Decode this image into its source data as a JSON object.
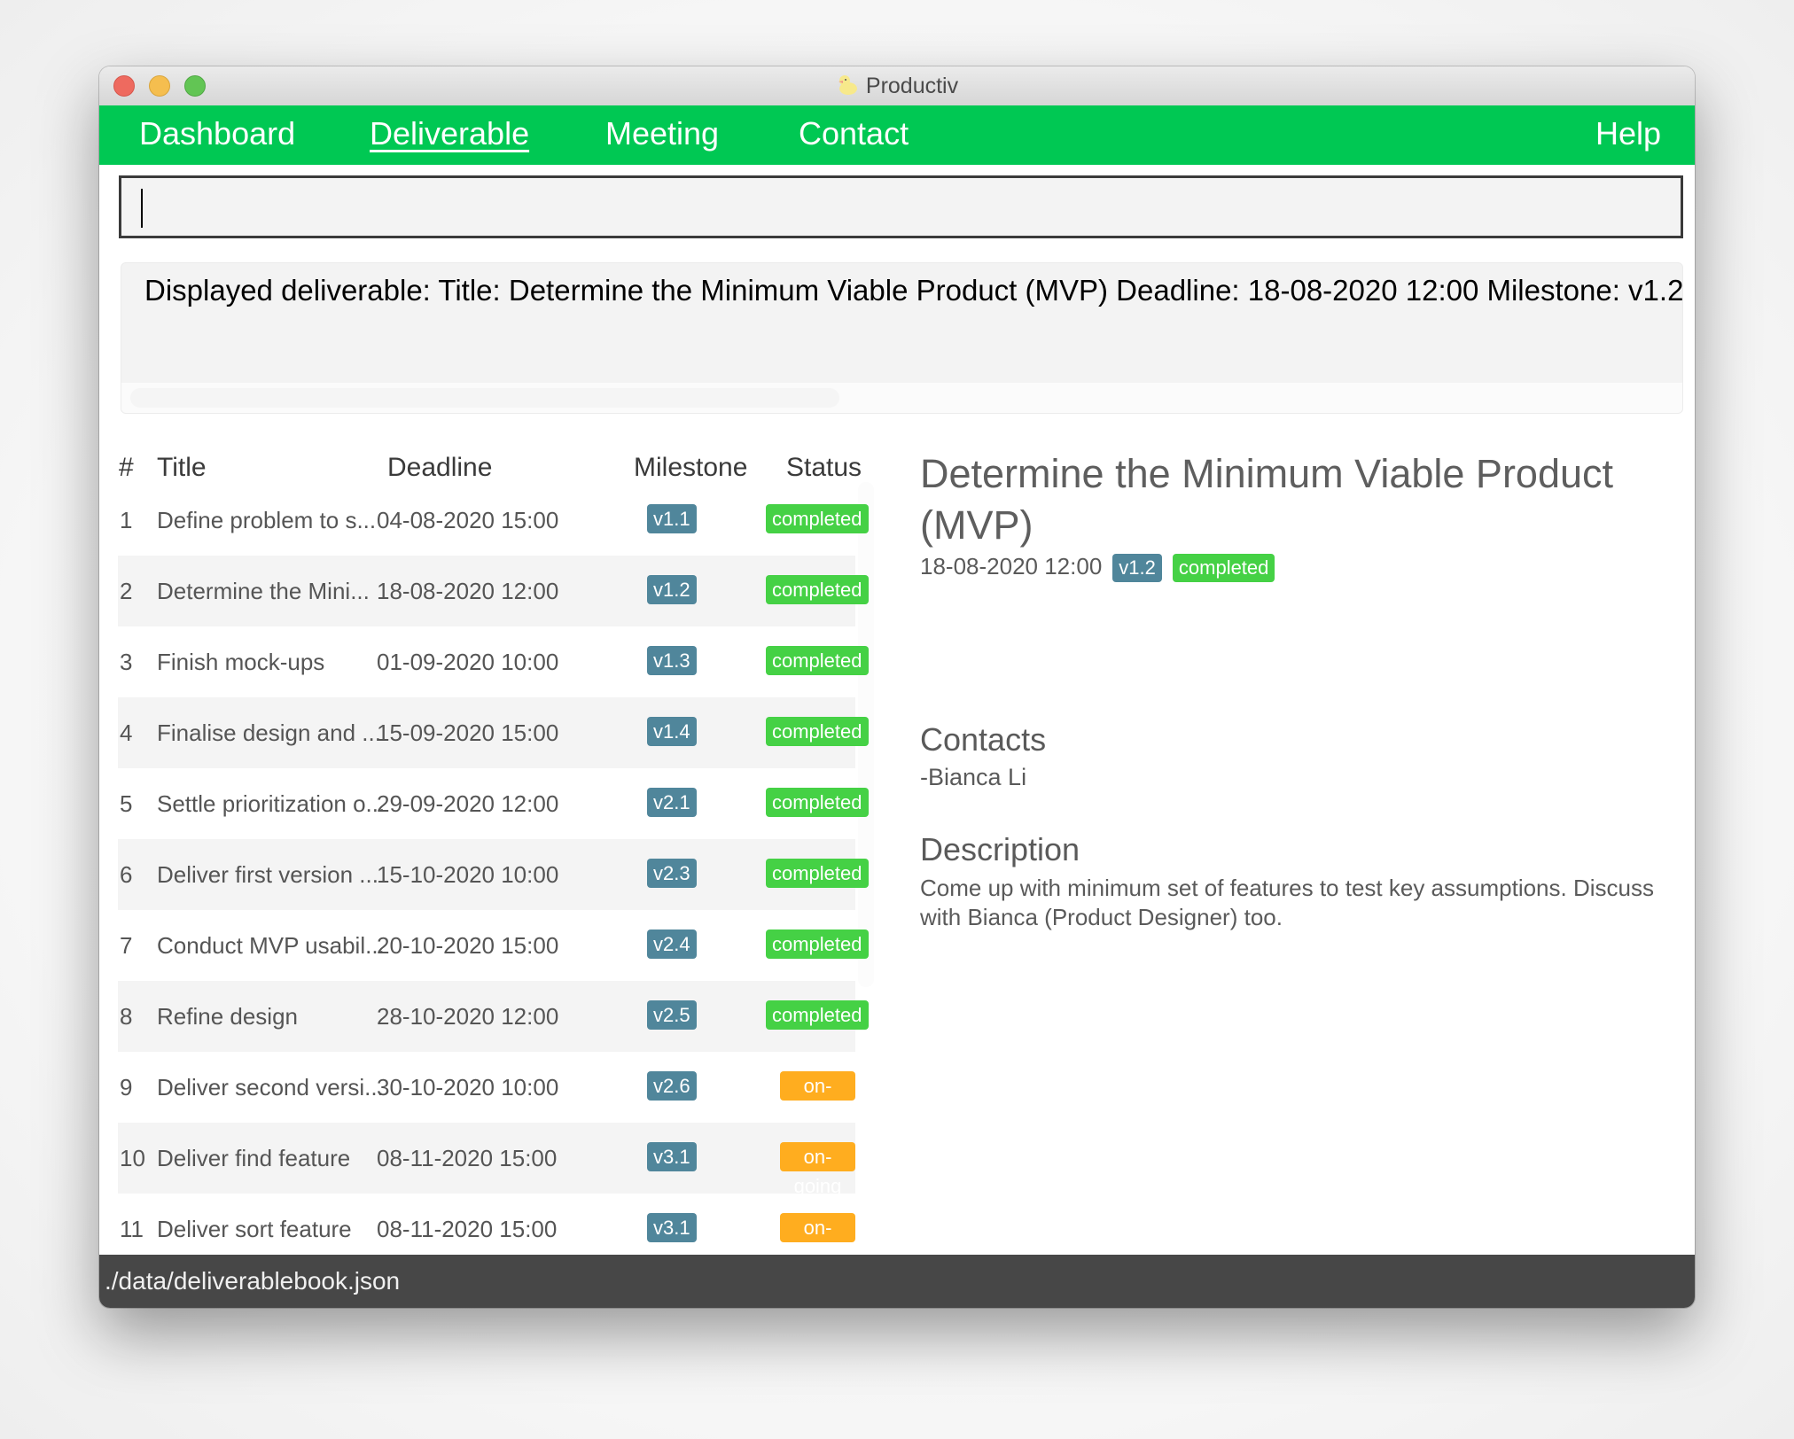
{
  "window": {
    "title": "Productiv",
    "app_icon": "rubber-duck-icon"
  },
  "nav": {
    "items": [
      {
        "label": "Dashboard",
        "active": false
      },
      {
        "label": "Deliverable",
        "active": true
      },
      {
        "label": "Meeting",
        "active": false
      },
      {
        "label": "Contact",
        "active": false
      }
    ],
    "help_label": "Help"
  },
  "command_box": {
    "value": "",
    "placeholder": ""
  },
  "result_display": {
    "text": "Displayed deliverable: Title: Determine the Minimum Viable Product (MVP) Deadline: 18-08-2020 12:00 Milestone: v1.2"
  },
  "list": {
    "headers": {
      "index": "#",
      "title": "Title",
      "deadline": "Deadline",
      "milestone": "Milestone",
      "status": "Status"
    },
    "rows": [
      {
        "index": "1",
        "title": "Define problem to s...",
        "deadline": "04-08-2020 15:00",
        "milestone": "v1.1",
        "status": "completed"
      },
      {
        "index": "2",
        "title": "Determine the Mini...",
        "deadline": "18-08-2020 12:00",
        "milestone": "v1.2",
        "status": "completed"
      },
      {
        "index": "3",
        "title": "Finish mock-ups",
        "deadline": "01-09-2020 10:00",
        "milestone": "v1.3",
        "status": "completed"
      },
      {
        "index": "4",
        "title": "Finalise design and ...",
        "deadline": "15-09-2020 15:00",
        "milestone": "v1.4",
        "status": "completed"
      },
      {
        "index": "5",
        "title": "Settle prioritization o...",
        "deadline": "29-09-2020 12:00",
        "milestone": "v2.1",
        "status": "completed"
      },
      {
        "index": "6",
        "title": "Deliver first version ...",
        "deadline": "15-10-2020 10:00",
        "milestone": "v2.3",
        "status": "completed"
      },
      {
        "index": "7",
        "title": "Conduct MVP usabil...",
        "deadline": "20-10-2020 15:00",
        "milestone": "v2.4",
        "status": "completed"
      },
      {
        "index": "8",
        "title": "Refine design",
        "deadline": "28-10-2020 12:00",
        "milestone": "v2.5",
        "status": "completed"
      },
      {
        "index": "9",
        "title": "Deliver second versi...",
        "deadline": "30-10-2020 10:00",
        "milestone": "v2.6",
        "status": "on-going"
      },
      {
        "index": "10",
        "title": "Deliver find feature",
        "deadline": "08-11-2020 15:00",
        "milestone": "v3.1",
        "status": "on-going"
      },
      {
        "index": "11",
        "title": "Deliver sort feature",
        "deadline": "08-11-2020 15:00",
        "milestone": "v3.1",
        "status": "on-going"
      }
    ]
  },
  "detail": {
    "title": "Determine the Minimum Viable Product (MVP)",
    "deadline": "18-08-2020 12:00",
    "milestone": "v1.2",
    "status": "completed",
    "contacts_heading": "Contacts",
    "contacts": [
      "-Bianca Li"
    ],
    "description_heading": "Description",
    "description": "Come up with minimum set of features to test key assumptions. Discuss with Bianca (Product Designer) too."
  },
  "status_bar": {
    "file_path": "./data/deliverablebook.json"
  },
  "colors": {
    "nav_green": "#00c853",
    "milestone_badge": "#50869b",
    "status_completed": "#45d145",
    "status_ongoing": "#ffad1f",
    "status_bar_bg": "#474747"
  }
}
